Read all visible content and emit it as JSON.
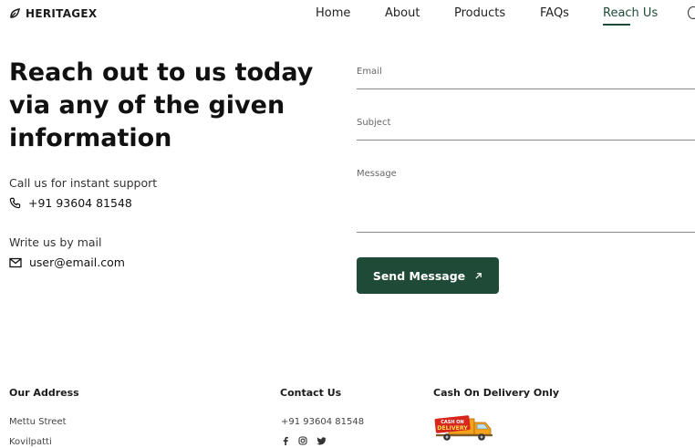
{
  "brand": {
    "name": "HERITAGEX"
  },
  "nav": {
    "items": [
      {
        "label": "Home"
      },
      {
        "label": "About"
      },
      {
        "label": "Products"
      },
      {
        "label": "FAQs"
      },
      {
        "label": "Reach Us"
      }
    ],
    "active": "Reach Us"
  },
  "hero": {
    "headline": "Reach out to us today via any of the given information",
    "support_label": "Call us for instant support",
    "phone": "+91 93604 81548",
    "mail_label": "Write us by mail",
    "email": "user@email.com"
  },
  "form": {
    "email_label": "Email",
    "email_value": "",
    "subject_label": "Subject",
    "subject_value": "",
    "message_label": "Message",
    "message_value": "",
    "submit_label": "Send Message"
  },
  "footer": {
    "address_heading": "Our Address",
    "address_line1": "Mettu Street",
    "address_line2": "Kovilpatti",
    "contact_heading": "Contact Us",
    "contact_phone": "+91 93604 81548",
    "socials": [
      "facebook-icon",
      "instagram-icon",
      "twitter-icon"
    ],
    "cod_heading": "Cash On Delivery Only",
    "cod_badge_top": "CASH ON",
    "cod_badge_bottom": "DELIVERY"
  },
  "colors": {
    "accent": "#1f4a37",
    "text": "#1b1b1b",
    "badge_red": "#d7261e",
    "truck_orange": "#f3a21a"
  }
}
